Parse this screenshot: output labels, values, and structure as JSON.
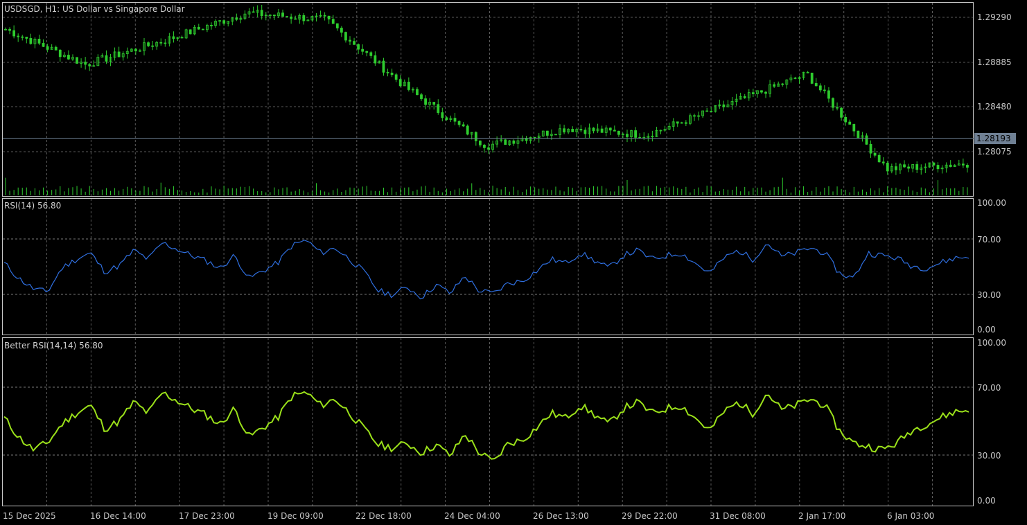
{
  "window": {
    "symbol_title": "USDSGD, H1:  US Dollar vs Singapore Dollar",
    "current_price": "1.28193"
  },
  "colors": {
    "background": "#000000",
    "candles": "#2ecc2e",
    "volume": "#2ecc2e",
    "rsi": "#2f6fe0",
    "better_rsi": "#9be11a",
    "bid_line": "#6f8094"
  },
  "price_axis": [
    "1.29290",
    "1.28885",
    "1.28480",
    "1.28075"
  ],
  "rsi_axis": [
    "100.00",
    "70.00",
    "30.00",
    "0.00"
  ],
  "better_rsi_axis": [
    "100.00",
    "70.00",
    "30.00",
    "0.00"
  ],
  "time_axis": [
    "15 Dec 2025",
    "16 Dec 14:00",
    "17 Dec 23:00",
    "19 Dec 09:00",
    "22 Dec 18:00",
    "24 Dec 04:00",
    "26 Dec 13:00",
    "29 Dec 22:00",
    "31 Dec 08:00",
    "2 Jan 17:00",
    "6 Jan 03:00"
  ],
  "rsi_title": "RSI(14) 56.80",
  "better_rsi_title": "Better RSI(14,14) 56.80",
  "chart_data": [
    {
      "type": "line",
      "title": "USDSGD, H1:  US Dollar vs Singapore Dollar",
      "description_series": "price (candlestick close approximations)",
      "x": [
        "15 Dec 2025",
        "16 Dec 14:00",
        "17 Dec 23:00",
        "19 Dec 09:00",
        "22 Dec 18:00",
        "24 Dec 04:00",
        "26 Dec 13:00",
        "29 Dec 22:00",
        "31 Dec 08:00",
        "2 Jan 17:00",
        "6 Jan 03:00",
        ""
      ],
      "series": [
        {
          "values": [
            1.2918,
            1.2892,
            1.291,
            1.293,
            1.2925,
            1.2875,
            1.2832,
            1.2845,
            1.284,
            1.2862,
            1.2885,
            1.2815,
            1.2819
          ]
        }
      ],
      "ylim": [
        1.2795,
        1.2938
      ]
    },
    {
      "type": "line",
      "title": "RSI(14) 56.80",
      "series": [
        {
          "values": [
            52,
            40,
            32,
            29,
            48,
            55,
            60,
            45,
            50,
            62,
            55,
            68,
            63,
            58,
            54,
            48,
            58,
            40,
            46,
            52,
            66,
            70,
            60,
            64,
            55,
            45,
            30,
            27,
            33,
            25,
            35,
            28,
            42,
            30,
            28,
            36,
            38,
            46,
            55,
            52,
            60,
            54,
            48,
            58,
            62,
            55,
            58,
            60,
            52,
            44,
            56,
            62,
            55,
            68,
            57,
            60,
            64,
            60,
            44,
            40,
            60,
            58,
            56,
            50,
            48,
            52,
            56,
            56.8
          ]
        }
      ],
      "ylim": [
        0,
        100
      ]
    },
    {
      "type": "line",
      "title": "Better RSI(14,14) 56.80",
      "series": [
        {
          "values": [
            52,
            40,
            32,
            36,
            48,
            55,
            60,
            45,
            50,
            62,
            55,
            68,
            63,
            58,
            54,
            48,
            58,
            40,
            46,
            52,
            66,
            68,
            60,
            64,
            55,
            45,
            35,
            33,
            36,
            30,
            35,
            28,
            42,
            30,
            24,
            36,
            38,
            46,
            55,
            52,
            60,
            54,
            48,
            58,
            62,
            55,
            58,
            60,
            52,
            44,
            56,
            62,
            55,
            68,
            57,
            60,
            64,
            60,
            44,
            36,
            34,
            32,
            36,
            44,
            48,
            52,
            56,
            56.8
          ]
        }
      ],
      "ylim": [
        0,
        100
      ]
    }
  ]
}
